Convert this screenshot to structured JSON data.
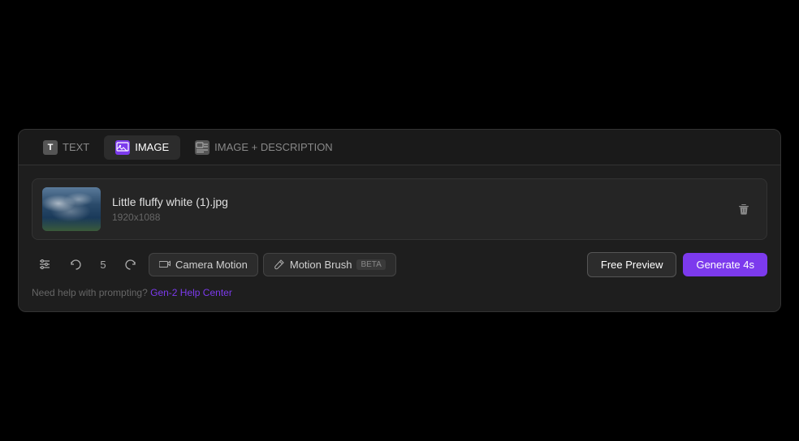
{
  "tabs": {
    "items": [
      {
        "id": "text",
        "label": "TEXT",
        "icon": "T",
        "active": false
      },
      {
        "id": "image",
        "label": "IMAGE",
        "icon": "img",
        "active": true
      },
      {
        "id": "image-description",
        "label": "IMAGE + DESCRIPTION",
        "icon": "img+",
        "active": false
      }
    ]
  },
  "image_card": {
    "filename": "Little fluffy white (1).jpg",
    "dimensions": "1920x1088"
  },
  "toolbar": {
    "number_value": "5",
    "camera_motion_label": "Camera Motion",
    "motion_brush_label": "Motion Brush",
    "beta_label": "BETA",
    "free_preview_label": "Free Preview",
    "generate_label": "Generate 4s"
  },
  "help": {
    "text": "Need help with prompting?",
    "link_text": "Gen-2 Help Center"
  },
  "colors": {
    "accent": "#7c3aed",
    "background": "#1e1e1e"
  }
}
